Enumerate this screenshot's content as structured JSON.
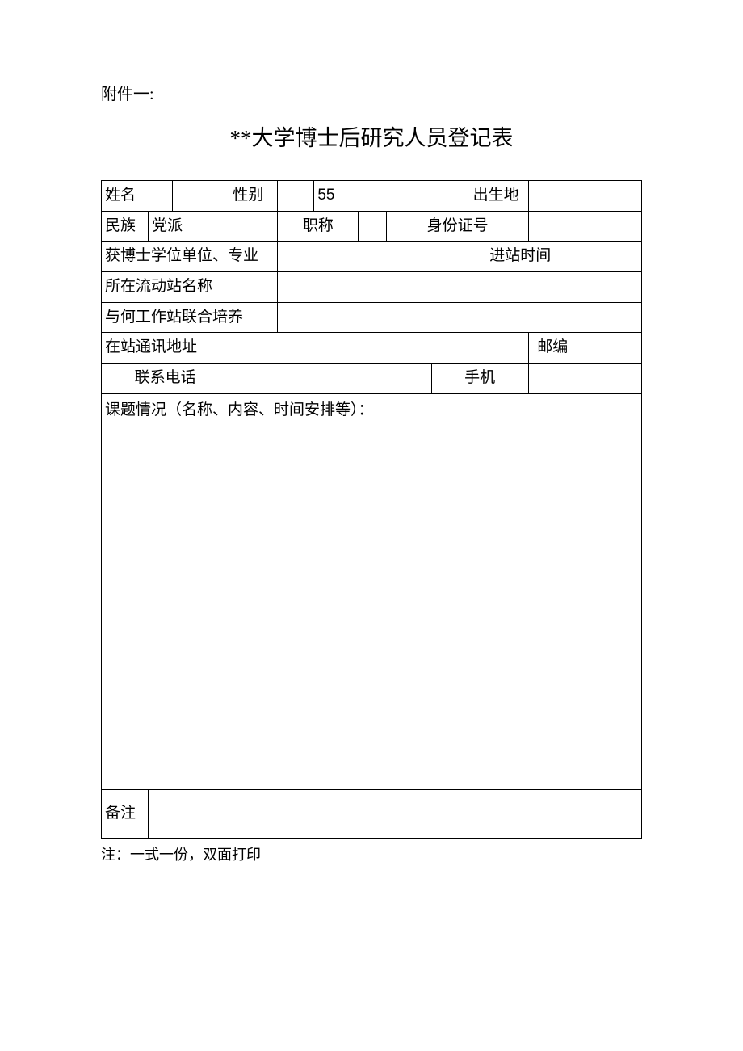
{
  "attachment_label": "附件一:",
  "title": "**大学博士后研究人员登记表",
  "labels": {
    "name": "姓名",
    "gender": "性别",
    "birthplace": "出生地",
    "ethnicity": "民族",
    "party": "党派",
    "title_rank": "职称",
    "id_number": "身份证号",
    "degree_unit": "获博士学位单位、专业",
    "entry_time": "进站时间",
    "station_name": "所在流动站名称",
    "joint_station": "与何工作站联合培养",
    "address": "在站通讯地址",
    "postcode": "邮编",
    "phone": "联系电话",
    "mobile": "手机",
    "topic": "课题情况（名称、内容、时间安排等）：",
    "remark": "备注"
  },
  "values": {
    "name": "",
    "gender": "",
    "number55": "55",
    "birthplace": "",
    "ethnicity": "",
    "party": "",
    "title_rank": "",
    "id_number": "",
    "degree_unit": "",
    "entry_time": "",
    "station_name": "",
    "joint_station": "",
    "address": "",
    "postcode": "",
    "phone": "",
    "mobile": "",
    "topic": "",
    "remark": ""
  },
  "footer_note": "注：一式一份，双面打印"
}
